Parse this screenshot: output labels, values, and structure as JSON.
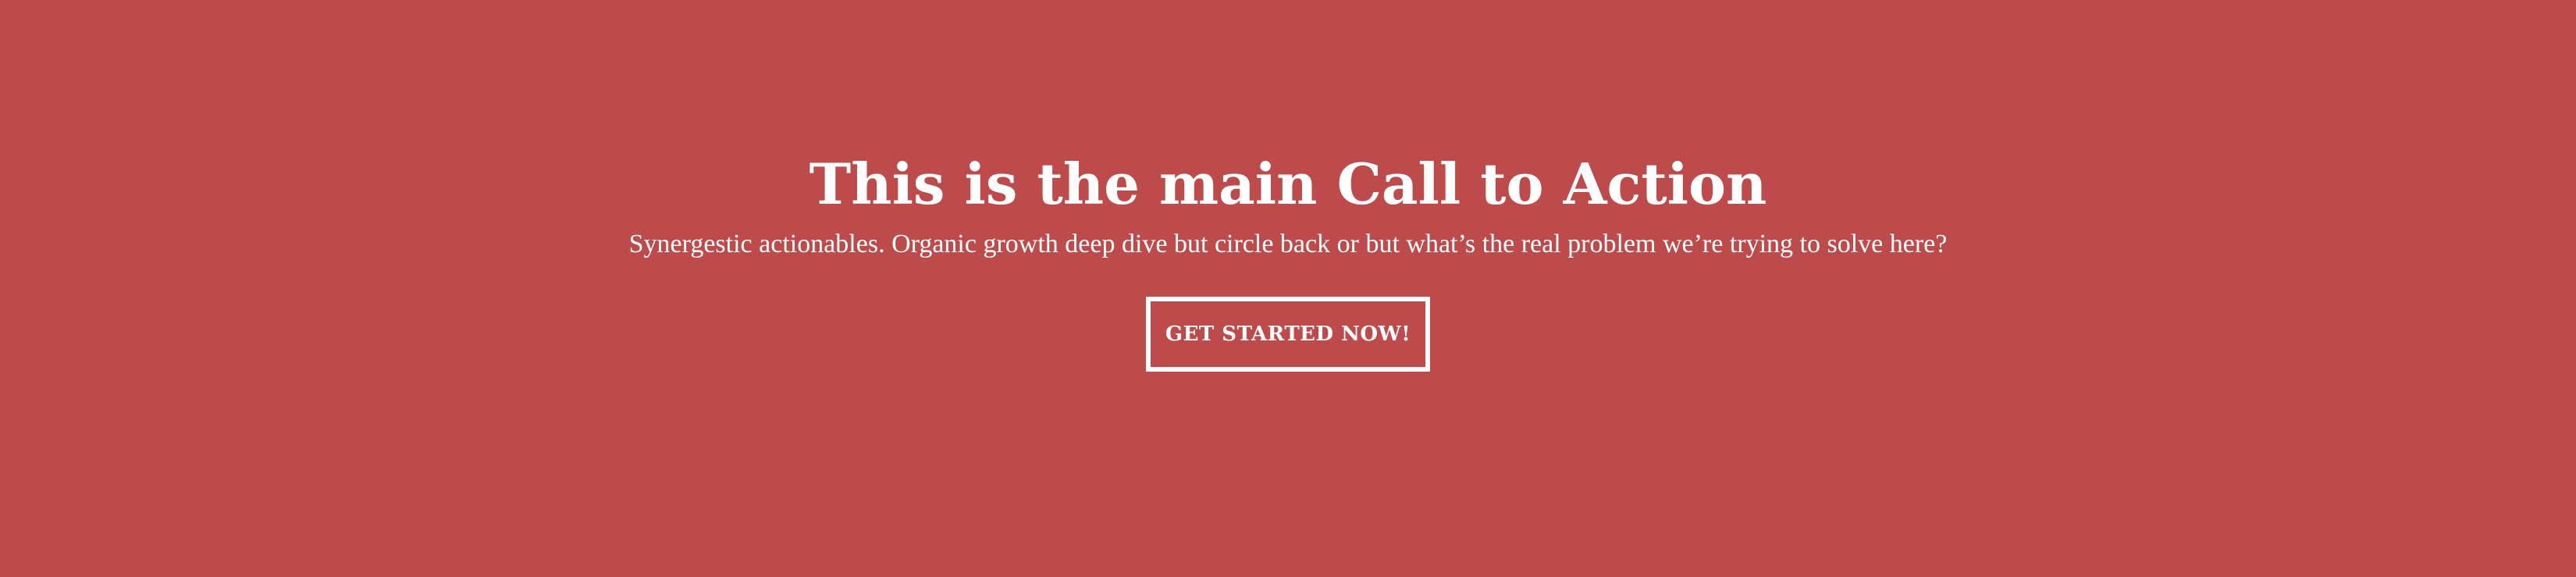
{
  "cta": {
    "title": "This is the main Call to Action",
    "subtitle": "Synergestic actionables. Organic growth deep dive but circle back or but what’s the real problem we’re trying to solve here?",
    "button_label": "GET STARTED NOW!"
  },
  "colors": {
    "background": "#bd4b4b",
    "text": "#ffffff",
    "button_border": "#ffffff"
  }
}
